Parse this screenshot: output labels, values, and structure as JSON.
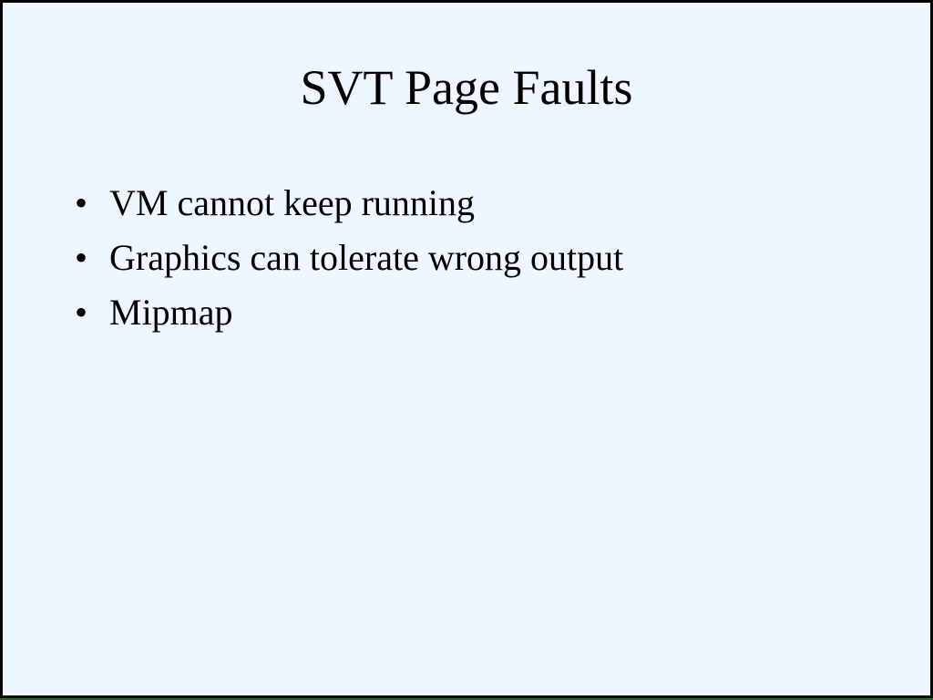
{
  "slide": {
    "title": "SVT Page Faults",
    "bullet_symbol": "•",
    "bullets": [
      "VM cannot keep running",
      "Graphics can tolerate wrong output",
      "Mipmap"
    ]
  },
  "colors": {
    "background": "#eef7ff",
    "border": "#000000",
    "text": "#000000",
    "bottom_edge": "#1f6b1f"
  }
}
